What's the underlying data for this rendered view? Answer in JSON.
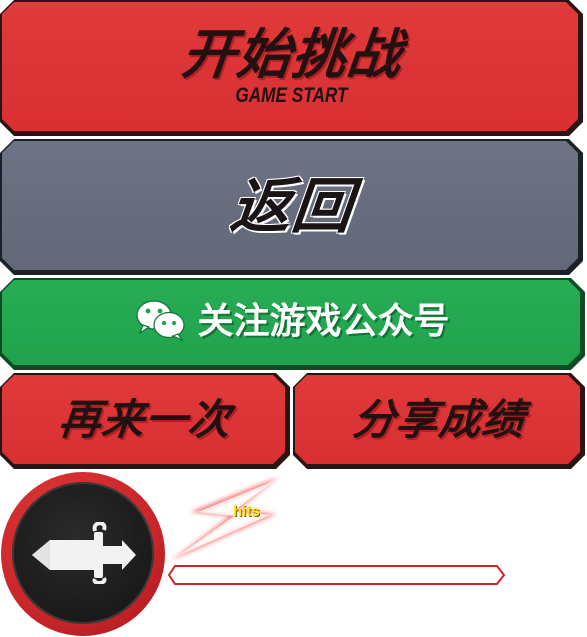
{
  "buttons": {
    "start_label": "开始挑战",
    "start_sub": "GAME START",
    "back_label": "返回",
    "wechat_label": "关注游戏公众号",
    "retry_label": "再来一次",
    "share_label": "分享成绩"
  },
  "hud": {
    "hits_label": "hits",
    "hits_progress": 0
  },
  "icons": {
    "wechat": "wechat-icon",
    "weapon": "sword-icon"
  },
  "colors": {
    "red": "#e03a3a",
    "gray": "#6e7385",
    "green": "#27ad55",
    "hits_yellow": "#ffe11a"
  }
}
